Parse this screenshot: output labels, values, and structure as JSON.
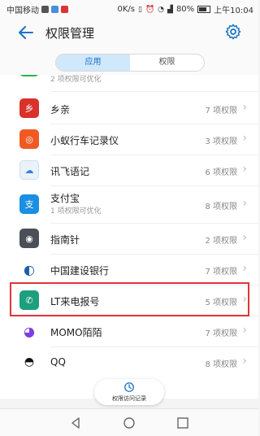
{
  "status_bar": {
    "carrier": "中国移动",
    "network_speed": "0K/s",
    "battery": "80%",
    "time": "上午10:04"
  },
  "appbar": {
    "title": "权限管理"
  },
  "tabs": [
    {
      "label": "应用",
      "active": true
    },
    {
      "label": "权限",
      "active": false
    }
  ],
  "partial_row": {
    "sub": "2 项权限可优化"
  },
  "apps": [
    {
      "name": "乡亲",
      "sub": "",
      "count": "7 项权限",
      "icon": "xiangqin-icon",
      "color": "#d8322b",
      "glyph": "乡"
    },
    {
      "name": "小蚁行车记录仪",
      "sub": "",
      "count": "3 项权限",
      "icon": "dashcam-icon",
      "color": "#f05a22",
      "glyph": "◎"
    },
    {
      "name": "讯飞语记",
      "sub": "",
      "count": "6 项权限",
      "icon": "voice-cloud-icon",
      "color": "#eaf2fa",
      "glyph": "☁"
    },
    {
      "name": "支付宝",
      "sub": "1 项权限可优化",
      "count": "8 项权限",
      "icon": "alipay-icon",
      "color": "#1a8fe3",
      "glyph": "支"
    },
    {
      "name": "指南针",
      "sub": "",
      "count": "2 项权限",
      "icon": "compass-icon",
      "color": "#4a4f58",
      "glyph": "◉"
    },
    {
      "name": "中国建设银行",
      "sub": "",
      "count": "7 项权限",
      "icon": "ccb-icon",
      "color": "#ffffff",
      "glyph": "◐"
    },
    {
      "name": "LT来电报号",
      "sub": "",
      "count": "5 项权限",
      "icon": "caller-id-icon",
      "color": "#1d9f7e",
      "glyph": "✆"
    },
    {
      "name": "MOMO陌陌",
      "sub": "",
      "count": "7 项权限",
      "icon": "momo-icon",
      "color": "#ffffff",
      "glyph": "◕"
    },
    {
      "name": "QQ",
      "sub": "",
      "count": "8 项权限",
      "icon": "qq-icon",
      "color": "#ffffff",
      "glyph": "🐧"
    }
  ],
  "fab": {
    "label": "权限访问记录"
  },
  "colors": {
    "accent": "#1a73c8",
    "highlight": "#e0343a"
  }
}
